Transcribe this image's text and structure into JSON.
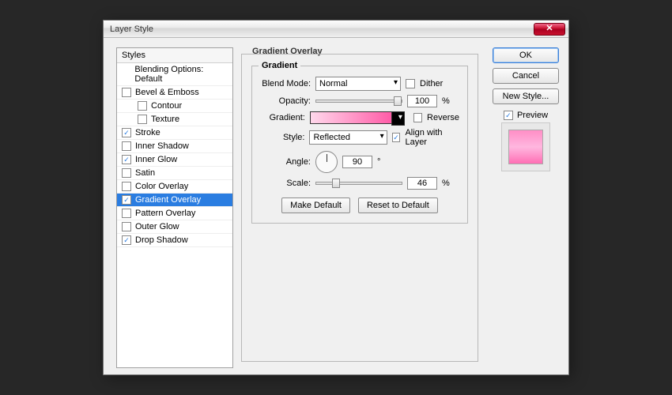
{
  "window": {
    "title": "Layer Style"
  },
  "sidebar": {
    "header": "Styles",
    "blending": "Blending Options: Default",
    "items": [
      {
        "label": "Bevel & Emboss",
        "checked": false,
        "indent": false
      },
      {
        "label": "Contour",
        "checked": false,
        "indent": true
      },
      {
        "label": "Texture",
        "checked": false,
        "indent": true
      },
      {
        "label": "Stroke",
        "checked": true,
        "indent": false
      },
      {
        "label": "Inner Shadow",
        "checked": false,
        "indent": false
      },
      {
        "label": "Inner Glow",
        "checked": true,
        "indent": false
      },
      {
        "label": "Satin",
        "checked": false,
        "indent": false
      },
      {
        "label": "Color Overlay",
        "checked": false,
        "indent": false
      },
      {
        "label": "Gradient Overlay",
        "checked": true,
        "indent": false,
        "selected": true
      },
      {
        "label": "Pattern Overlay",
        "checked": false,
        "indent": false
      },
      {
        "label": "Outer Glow",
        "checked": false,
        "indent": false
      },
      {
        "label": "Drop Shadow",
        "checked": true,
        "indent": false
      }
    ]
  },
  "panel": {
    "title": "Gradient Overlay",
    "group": "Gradient",
    "blend_mode_label": "Blend Mode:",
    "blend_mode_value": "Normal",
    "dither_label": "Dither",
    "dither_checked": false,
    "opacity_label": "Opacity:",
    "opacity_value": "100",
    "opacity_suffix": "%",
    "gradient_label": "Gradient:",
    "reverse_label": "Reverse",
    "reverse_checked": false,
    "style_label": "Style:",
    "style_value": "Reflected",
    "align_label": "Align with Layer",
    "align_checked": true,
    "angle_label": "Angle:",
    "angle_value": "90",
    "angle_suffix": "°",
    "scale_label": "Scale:",
    "scale_value": "46",
    "scale_suffix": "%",
    "make_default": "Make Default",
    "reset_default": "Reset to Default"
  },
  "right": {
    "ok": "OK",
    "cancel": "Cancel",
    "new_style": "New Style...",
    "preview_label": "Preview",
    "preview_checked": true
  },
  "colors": {
    "gradient_start": "#ffd8eb",
    "gradient_end": "#ff5ba7"
  }
}
